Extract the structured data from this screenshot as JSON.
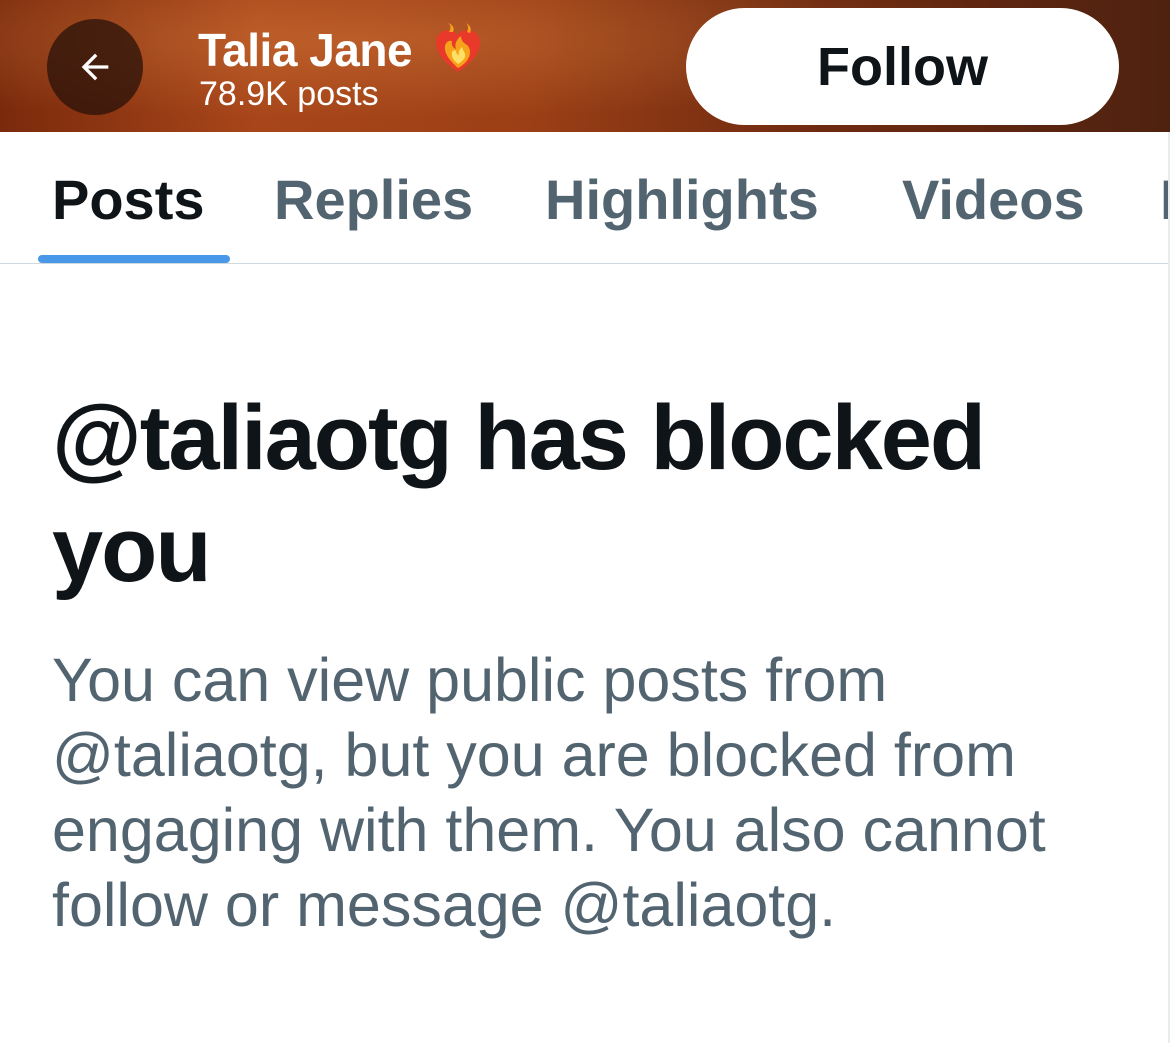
{
  "header": {
    "back_label": "Back",
    "profile_name": "Talia Jane",
    "post_count": "78.9K posts",
    "badge_icon": "heart-on-fire-icon",
    "follow_label": "Follow",
    "colors": {
      "banner_start": "#7a2a0c",
      "banner_end": "#4e2210",
      "button_bg": "#ffffff",
      "button_text": "#0f1419"
    }
  },
  "tabs": [
    {
      "label": "Posts",
      "active": true
    },
    {
      "label": "Replies",
      "active": false
    },
    {
      "label": "Highlights",
      "active": false
    },
    {
      "label": "Videos",
      "active": false
    },
    {
      "label": "M",
      "active": false
    }
  ],
  "accent_color": "#4a99e9",
  "blocked": {
    "title": "@taliaotg has blocked you",
    "description": "You can view public posts from @taliaotg, but you are blocked from engaging with them. You also cannot follow or message @taliaotg."
  }
}
